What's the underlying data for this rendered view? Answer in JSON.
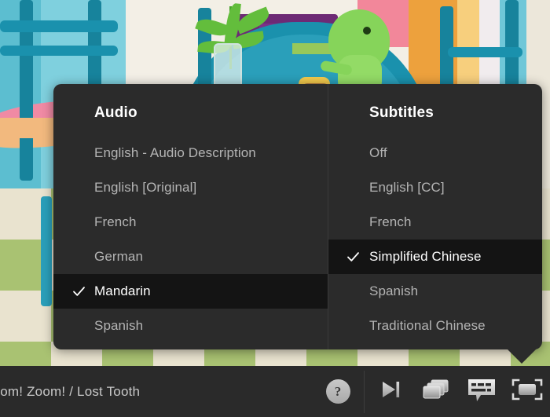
{
  "player": {
    "title": "Zoom! Zoom! / Lost Tooth",
    "settings_panel": {
      "audio": {
        "heading": "Audio",
        "options": [
          {
            "label": "English - Audio Description",
            "selected": false
          },
          {
            "label": "English [Original]",
            "selected": false
          },
          {
            "label": "French",
            "selected": false
          },
          {
            "label": "German",
            "selected": false
          },
          {
            "label": "Mandarin",
            "selected": true
          },
          {
            "label": "Spanish",
            "selected": false
          }
        ]
      },
      "subtitles": {
        "heading": "Subtitles",
        "options": [
          {
            "label": "Off",
            "selected": false
          },
          {
            "label": "English [CC]",
            "selected": false
          },
          {
            "label": "French",
            "selected": false
          },
          {
            "label": "Simplified Chinese",
            "selected": true
          },
          {
            "label": "Spanish",
            "selected": false
          },
          {
            "label": "Traditional Chinese",
            "selected": false
          }
        ]
      },
      "checkmark_icon": "check-icon"
    },
    "controls": [
      {
        "name": "help-button",
        "icon": "question-mark-icon",
        "label": "?"
      },
      {
        "name": "next-episode-button",
        "icon": "skip-next-icon",
        "label": ""
      },
      {
        "name": "episodes-button",
        "icon": "stacked-cards-icon",
        "label": ""
      },
      {
        "name": "subtitles-button",
        "icon": "speech-bubble-icon",
        "label": ""
      },
      {
        "name": "fullscreen-button",
        "icon": "fullscreen-icon",
        "label": ""
      }
    ],
    "colors": {
      "panel_background": "#2b2b2b",
      "selected_row_background": "#141414",
      "option_text": "#b4b4b4",
      "selected_text": "#ffffff",
      "control_bar_background": "#2a2a2a"
    }
  }
}
